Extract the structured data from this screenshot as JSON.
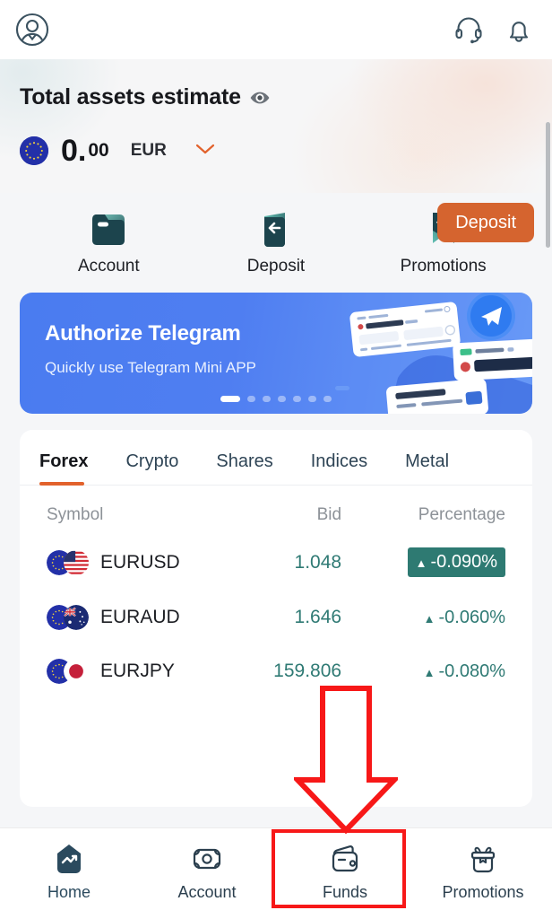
{
  "header": {
    "avatar_icon": "user-circle-icon",
    "support_icon": "headset-icon",
    "notification_icon": "bell-icon"
  },
  "assets": {
    "title": "Total assets estimate",
    "visibility_icon": "eye-icon",
    "currency_flag": "eu-flag-icon",
    "amount_whole": "0.",
    "amount_decimals": "00",
    "currency": "EUR",
    "currency_chevron_icon": "chevron-down-icon",
    "deposit_label": "Deposit",
    "deposit_color": "#d5642f"
  },
  "quick_actions": [
    {
      "label": "Account",
      "icon": "wallet-card-icon"
    },
    {
      "label": "Deposit",
      "icon": "deposit-arrow-icon"
    },
    {
      "label": "Promotions",
      "icon": "bookmark-star-icon"
    }
  ],
  "banner": {
    "title": "Authorize Telegram",
    "subtitle": "Quickly use Telegram Mini APP",
    "art_icon": "telegram-cards-illustration",
    "dot_count": 7,
    "active_dot": 0,
    "bg_color": "#4f7ef1"
  },
  "market": {
    "tabs": [
      {
        "label": "Forex",
        "active": true
      },
      {
        "label": "Crypto",
        "active": false
      },
      {
        "label": "Shares",
        "active": false
      },
      {
        "label": "Indices",
        "active": false
      },
      {
        "label": "Metal",
        "active": false
      }
    ],
    "active_underline_color": "#e2622c",
    "columns": [
      "Symbol",
      "Bid",
      "Percentage"
    ],
    "rows": [
      {
        "symbol": "EURUSD",
        "bid": "1.048",
        "percentage": "-0.090%",
        "trend_icon": "triangle-up-icon",
        "highlighted": true,
        "flag_a": "eu-flag-icon",
        "flag_b": "us-flag-icon"
      },
      {
        "symbol": "EURAUD",
        "bid": "1.646",
        "percentage": "-0.060%",
        "trend_icon": "triangle-up-icon",
        "highlighted": false,
        "flag_a": "eu-flag-icon",
        "flag_b": "au-flag-icon"
      },
      {
        "symbol": "EURJPY",
        "bid": "159.806",
        "percentage": "-0.080%",
        "trend_icon": "triangle-up-icon",
        "highlighted": false,
        "flag_a": "eu-flag-icon",
        "flag_b": "jp-flag-icon"
      }
    ],
    "value_color": "#2f7a74",
    "badge_color": "#2e7a72"
  },
  "bottom_nav": [
    {
      "label": "Home",
      "icon": "home-chart-icon",
      "active": true
    },
    {
      "label": "Account",
      "icon": "banknote-icon",
      "active": false
    },
    {
      "label": "Funds",
      "icon": "wallet-icon",
      "active": false
    },
    {
      "label": "Promotions",
      "icon": "gift-icon",
      "active": false
    }
  ],
  "annotation": {
    "arrow_icon": "red-down-arrow-annotation",
    "box_target": "Funds",
    "color": "#f71818"
  }
}
